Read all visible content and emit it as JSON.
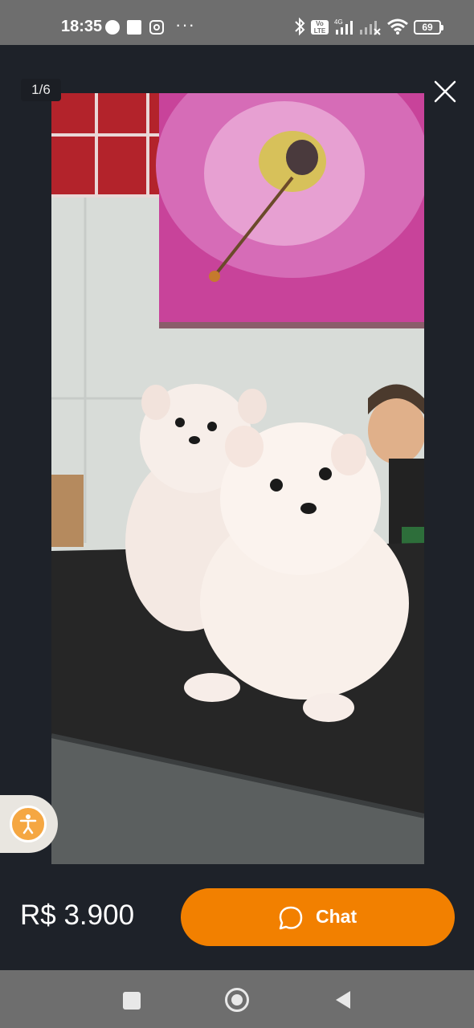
{
  "status_bar": {
    "time": "18:35",
    "more": "···",
    "volte": "Vo LTE",
    "network": "4G",
    "battery": "69"
  },
  "gallery": {
    "counter": "1/6",
    "photo_description_icon": "puppies-photo"
  },
  "listing": {
    "price": "R$ 3.900",
    "chat_label": "Chat"
  },
  "colors": {
    "accent": "#f28000",
    "background": "#1e2229",
    "accessibility": "#f5a742"
  }
}
